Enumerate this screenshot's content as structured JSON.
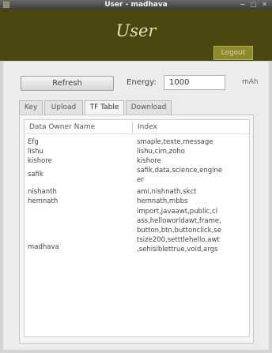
{
  "window": {
    "title": "User - madhava"
  },
  "header": {
    "logo_text": "User",
    "logout_label": "Logout"
  },
  "toolbar": {
    "refresh_label": "Refresh",
    "energy_label": "Energy:",
    "energy_value": "1000",
    "energy_unit": "mAh"
  },
  "tabs": [
    {
      "label": "Key",
      "active": false
    },
    {
      "label": "Upload",
      "active": false
    },
    {
      "label": "TF Table",
      "active": true
    },
    {
      "label": "Download",
      "active": false
    }
  ],
  "table": {
    "columns": [
      "Data Owner Name",
      "Index"
    ],
    "rows": [
      {
        "name": "Efg",
        "index": "smaple,texte,message"
      },
      {
        "name": "lishu",
        "index": "lishu,cim,zoho"
      },
      {
        "name": "kishore",
        "index": "kishore"
      },
      {
        "name": "safik",
        "index": "safik,data,science,engine\ner"
      },
      {
        "name": "nishanth",
        "index": "ami,nishnath,skct"
      },
      {
        "name": "hemnath",
        "index": "hemnath,mbbs"
      },
      {
        "name": "madhava",
        "index": "import,javaawt,public,cl\nass,helloworldawt,frame,\nbutton,btn,buttonclick,se\ntsize200,setttlehello,awt\n,sehisiblettrue,void,args"
      }
    ]
  }
}
